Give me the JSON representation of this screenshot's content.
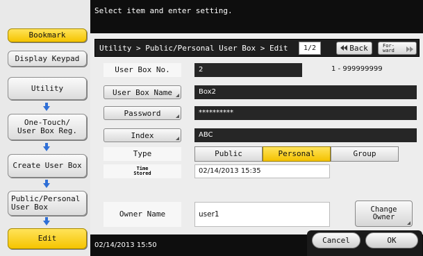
{
  "header": {
    "message": "Select item and enter setting."
  },
  "nav": {
    "bookmark": "Bookmark",
    "display_keypad": "Display Keypad",
    "utility": "Utility",
    "one_touch": "One-Touch/\nUser Box Reg.",
    "create_user_box": "Create User Box",
    "public_personal": "Public/Personal\nUser Box",
    "edit": "Edit"
  },
  "breadcrumb": "Utility > Public/Personal User  Box > Edit",
  "pager": {
    "page": "1/2",
    "back": "Back",
    "forward": "For-\nward"
  },
  "form": {
    "user_box_no_label": "User Box No.",
    "user_box_no_value": "2",
    "range": "1 - 999999999",
    "user_box_name_label": "User Box Name",
    "user_box_name_value": "Box2",
    "password_label": "Password",
    "password_value": "**********",
    "index_label": "Index",
    "index_value": "ABC",
    "type_label": "Type",
    "type_options": [
      "Public",
      "Personal",
      "Group"
    ],
    "type_selected": "Personal",
    "time_stored_label": "Time\nStored",
    "time_stored_value": "02/14/2013   15:35",
    "owner_name_label": "Owner Name",
    "owner_name_value": "user1",
    "change_owner": "Change\nOwner"
  },
  "footer": {
    "datetime": "02/14/2013   15:50",
    "cancel": "Cancel",
    "ok": "OK"
  },
  "colors": {
    "accent": "#f5c400",
    "bar": "#0e0e0e",
    "panel": "#ededed"
  },
  "icons": {
    "nav_arrow": "arrow-down-icon",
    "back": "double-left-arrow-icon",
    "forward": "double-right-arrow-icon"
  }
}
